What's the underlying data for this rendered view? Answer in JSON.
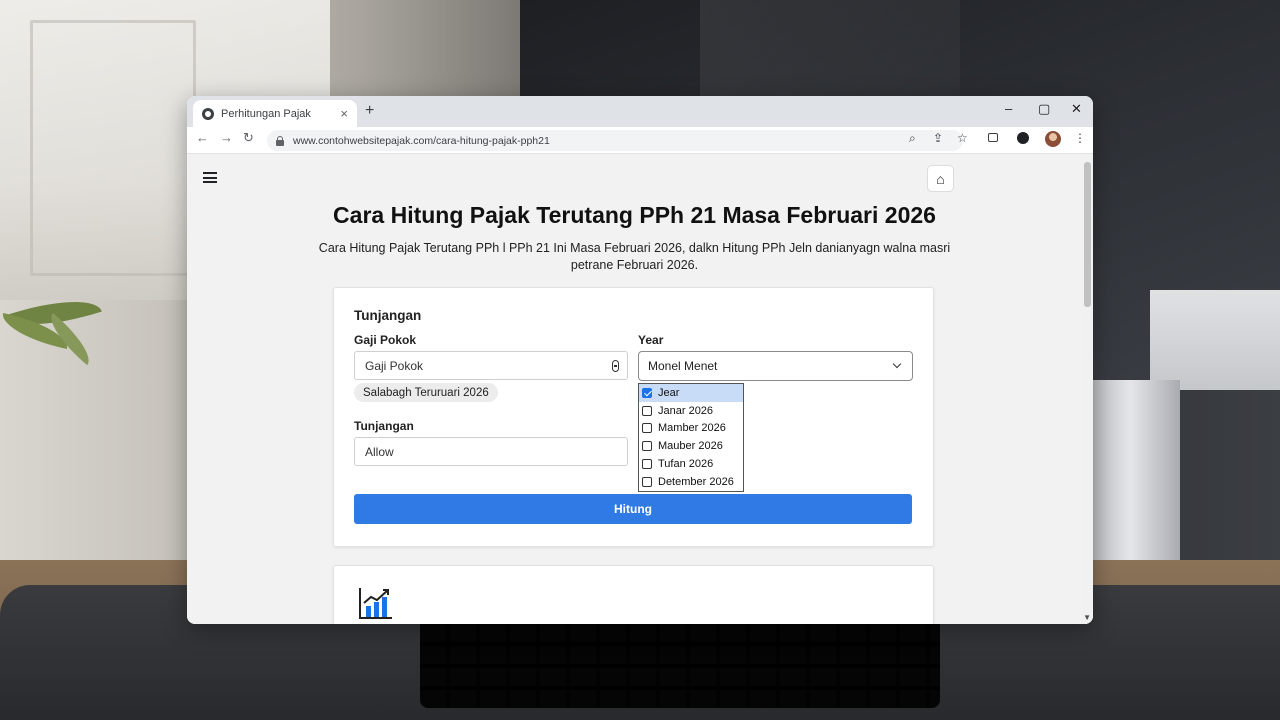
{
  "browser": {
    "tab_title": "Perhitungan Pajak",
    "tab_close": "×",
    "new_tab": "+",
    "url": "www.contohwebsitepajak.com/cara-hitung-pajak-pph21",
    "controls": {
      "minimize": "–",
      "maximize": "▢",
      "close": "✕"
    },
    "nav": {
      "back": "←",
      "forward": "→",
      "reload": "↻"
    },
    "toolbar_icons": {
      "zoom": "⌕",
      "share": "⇪",
      "bookmark": "☆",
      "menu": "⋮"
    }
  },
  "page": {
    "home_icon": "⌂",
    "title": "Cara Hitung Pajak Terutang PPh 21 Masa Februari 2026",
    "subtitle": "Cara Hitung Pajak Terutang PPh l PPh 21 Ini Masa Februari 2026, dalkn Hitung PPh Jeln danianyagn walna masri petrane Februari 2026."
  },
  "form": {
    "section_title": "Tunjangan",
    "gaji_pokok": {
      "label": "Gaji Pokok",
      "value": "Gaji Pokok"
    },
    "chip": "Salabagh Teruruari 2026",
    "tunjangan": {
      "label": "Tunjangan",
      "value": "Allow"
    },
    "year": {
      "label": "Year",
      "value": "Monel Menet",
      "options": [
        {
          "label": "Jear",
          "checked": true
        },
        {
          "label": "Janar 2026",
          "checked": false
        },
        {
          "label": "Mamber 2026",
          "checked": false
        },
        {
          "label": "Mauber 2026",
          "checked": false
        },
        {
          "label": "Tufan 2026",
          "checked": false
        },
        {
          "label": "Detember 2026",
          "checked": false
        }
      ]
    },
    "submit": "Hitung"
  },
  "colors": {
    "accent": "#2f7ae5",
    "selected_option": "#c8dcf7",
    "chart_icon": "#1a73e8"
  },
  "icons": {
    "chart": "bar-chart-icon"
  }
}
